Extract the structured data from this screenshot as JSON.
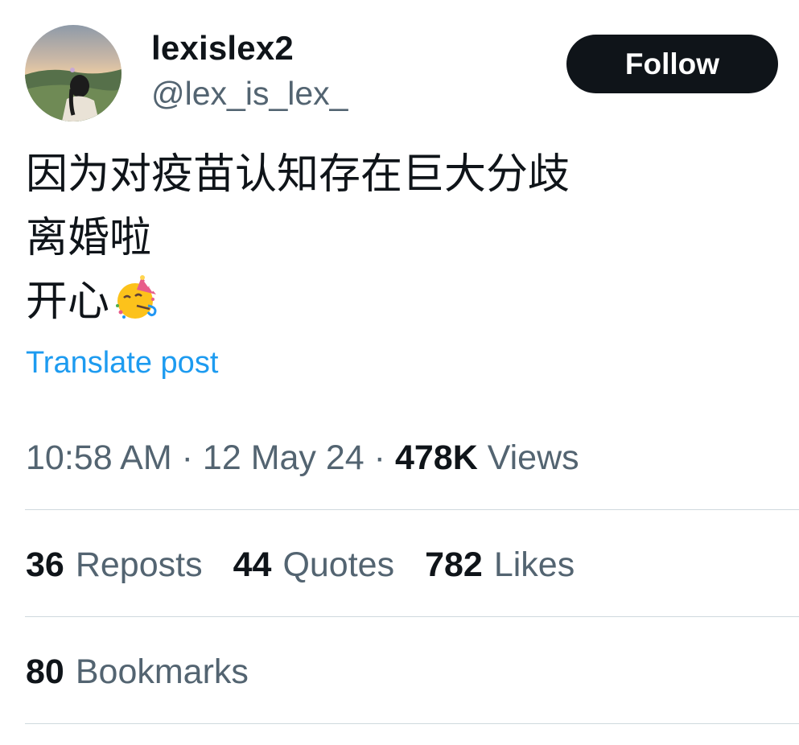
{
  "author": {
    "display_name": "lexislex2",
    "handle": "@lex_is_lex_"
  },
  "follow_label": "Follow",
  "post": {
    "lines": [
      "因为对疫苗认知存在巨大分歧",
      "离婚啦",
      "开心"
    ],
    "emoji_icon": "partying-face-icon"
  },
  "translate_label": "Translate post",
  "meta": {
    "time": "10:58 AM",
    "date": "12 May 24",
    "separator": "·",
    "views_count": "478K",
    "views_label": "Views"
  },
  "stats": {
    "reposts_count": "36",
    "reposts_label": "Reposts",
    "quotes_count": "44",
    "quotes_label": "Quotes",
    "likes_count": "782",
    "likes_label": "Likes",
    "bookmarks_count": "80",
    "bookmarks_label": "Bookmarks"
  },
  "colors": {
    "text_primary": "#0f1419",
    "text_secondary": "#536471",
    "link": "#1d9bf0",
    "divider": "#cfd9de",
    "follow_bg": "#0f1419"
  }
}
